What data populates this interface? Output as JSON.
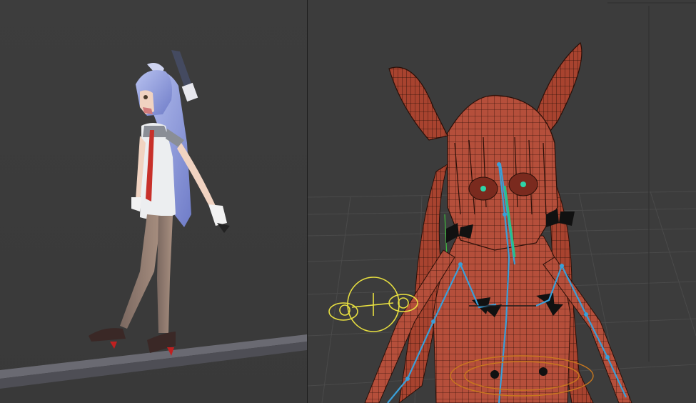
{
  "colors": {
    "viewport_background": "#3b3b3b",
    "divider": "#1d1d1d",
    "grid_line": "#474747",
    "mesh_fill": "#b54f3b",
    "wire": "#2a0f08",
    "bone": "#3a9fd8",
    "control_yellow": "#e8e040",
    "control_orange": "#c8781e",
    "eye_highlight": "#2ed4a8"
  },
  "icons": {
    "character_render": "anime-character-render",
    "wireframe_mesh": "wireframe-mesh",
    "armature": "armature-bones",
    "eye_control": "eye-controller"
  }
}
